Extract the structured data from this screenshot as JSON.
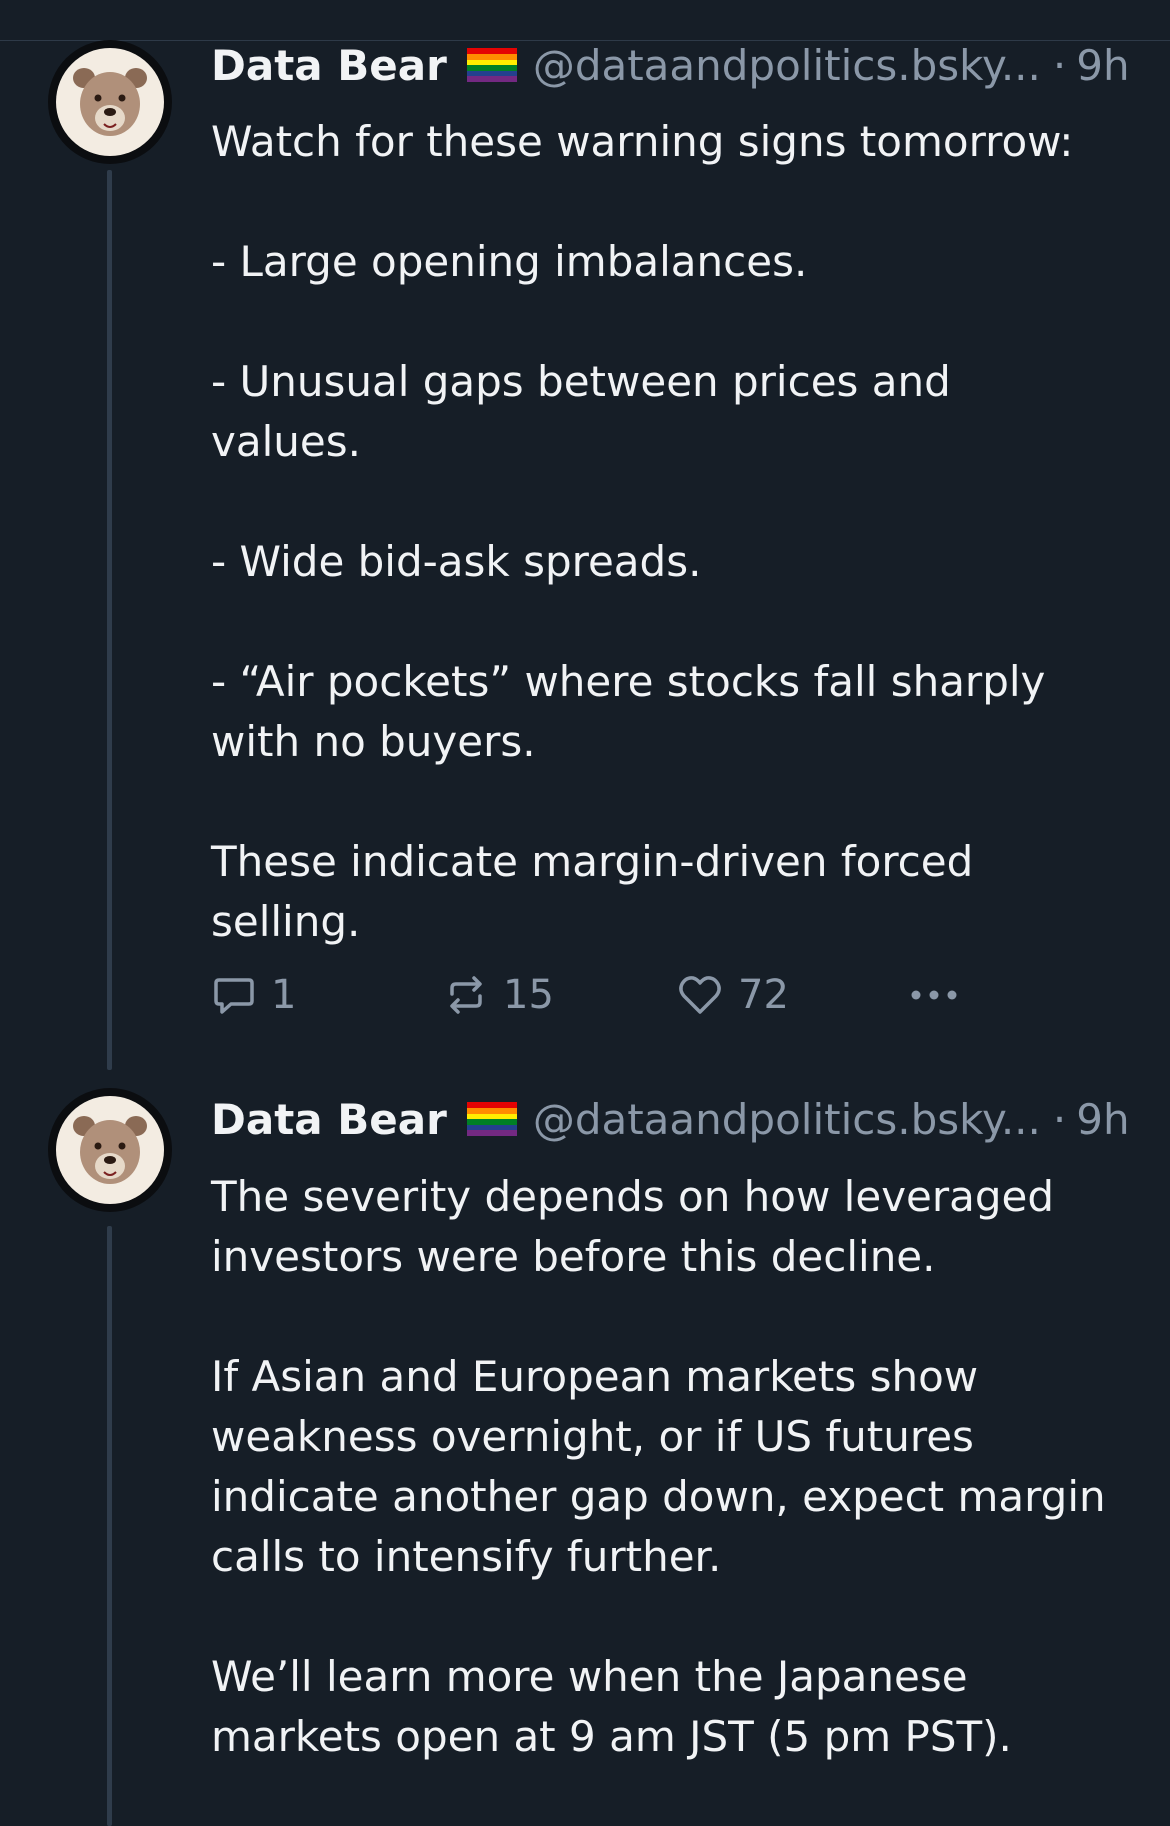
{
  "posts": [
    {
      "author": "Data Bear",
      "handle": "@dataandpolitics.bsky...",
      "separator": "·",
      "time": "9h",
      "paragraphs": [
        "Watch for these warning signs tomorrow:",
        "- Large opening imbalances.",
        "- Unusual gaps between prices and values.",
        "- Wide bid-ask spreads.",
        "- “Air pockets” where stocks fall sharply with no buyers.",
        "These indicate margin-driven forced selling."
      ],
      "reply_count": "1",
      "repost_count": "15",
      "like_count": "72"
    },
    {
      "author": "Data Bear",
      "handle": "@dataandpolitics.bsky...",
      "separator": "·",
      "time": "9h",
      "paragraphs": [
        "The severity depends on how leveraged investors were before this decline.",
        "If Asian and European markets show weakness overnight, or if US futures indicate another gap down, expect margin calls to intensify further.",
        "We’ll learn more when the Japanese markets open at 9 am JST (5 pm PST)."
      ]
    }
  ],
  "icons": {
    "avatar": "bear-avatar-icon",
    "flag": "rainbow-flag-icon",
    "reply": "reply-icon",
    "repost": "repost-icon",
    "like": "heart-icon",
    "more": "more-options-icon"
  },
  "colors": {
    "background": "#161e27",
    "text": "#f1f3f5",
    "muted": "#8b98a8",
    "thread_line": "#2f3c4b"
  }
}
